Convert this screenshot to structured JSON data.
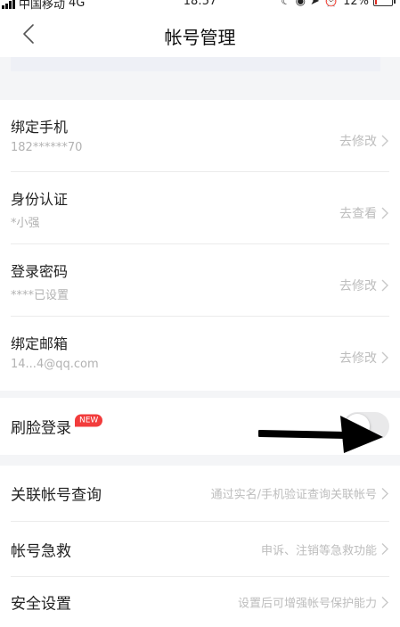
{
  "status_bar": {
    "carrier": "中国移动",
    "network": "4G",
    "time": "18:57",
    "battery": "12%",
    "battery_level": 0.12,
    "battery_color": "#e02e24"
  },
  "nav": {
    "back_icon": "chevron-left-icon",
    "title": "帐号管理"
  },
  "account_items": [
    {
      "title": "绑定手机",
      "subtitle": "182******70",
      "action": "去修改"
    },
    {
      "title": "身份认证",
      "subtitle": "*小强",
      "action": "去查看"
    },
    {
      "title": "登录密码",
      "subtitle": "****已设置",
      "action": "去修改"
    },
    {
      "title": "绑定邮箱",
      "subtitle": "14...4@qq.com",
      "action": "去修改"
    }
  ],
  "face_login": {
    "title": "刷脸登录",
    "badge": "NEW",
    "badge_color": "#f23c3c",
    "enabled": false
  },
  "more_items": [
    {
      "title": "关联帐号查询",
      "action": "通过实名/手机验证查询关联帐号"
    },
    {
      "title": "帐号急救",
      "action": "申诉、注销等急救功能"
    },
    {
      "title": "安全设置",
      "action": "设置后可增强帐号保护能力"
    }
  ]
}
